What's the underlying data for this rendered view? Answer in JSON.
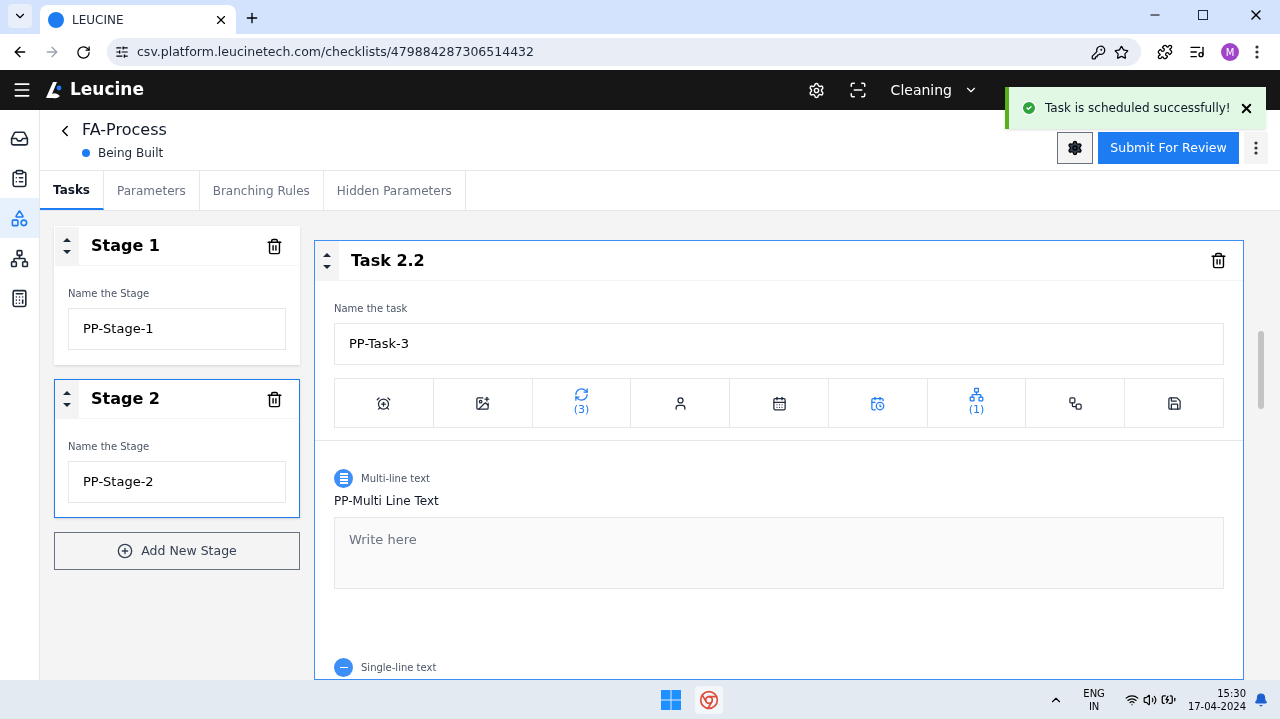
{
  "browser": {
    "tab_title": "LEUCINE",
    "url": "csv.platform.leucinetech.com/checklists/479884287306514432",
    "profile_initial": "M"
  },
  "header": {
    "brand": "Leucine",
    "facility": "Cleaning"
  },
  "toast": {
    "message": "Task is scheduled successfully!"
  },
  "page": {
    "title": "FA-Process",
    "status": "Being Built",
    "submit_label": "Submit For Review"
  },
  "sidebar": {
    "items": [
      {
        "kind": "inbox",
        "selected": false
      },
      {
        "kind": "checklist",
        "selected": false
      },
      {
        "kind": "flow",
        "selected": true
      },
      {
        "kind": "hierarchy",
        "selected": false
      },
      {
        "kind": "report",
        "selected": false
      }
    ]
  },
  "tabs": [
    {
      "label": "Tasks",
      "selected": true
    },
    {
      "label": "Parameters",
      "selected": false
    },
    {
      "label": "Branching Rules",
      "selected": false
    },
    {
      "label": "Hidden Parameters",
      "selected": false
    }
  ],
  "stages": [
    {
      "title": "Stage 1",
      "field_label": "Name the Stage",
      "value": "PP-Stage-1",
      "selected": false
    },
    {
      "title": "Stage 2",
      "field_label": "Name the Stage",
      "value": "PP-Stage-2",
      "selected": true
    }
  ],
  "add_stage": "Add New Stage",
  "task": {
    "title": "Task 2.2",
    "field_label": "Name the task",
    "value": "PP-Task-3",
    "toolbar": [
      {
        "kind": "timer",
        "active": false
      },
      {
        "kind": "media",
        "active": false
      },
      {
        "kind": "recurrence",
        "active": true,
        "count": "(3)"
      },
      {
        "kind": "assignee",
        "active": false
      },
      {
        "kind": "schedule-refresh",
        "active": false
      },
      {
        "kind": "schedule",
        "active": true
      },
      {
        "kind": "branch",
        "active": true,
        "count": "(1)"
      },
      {
        "kind": "interlock",
        "active": false
      },
      {
        "kind": "lock",
        "active": false
      }
    ],
    "parameters": [
      {
        "kind": "multi",
        "type_label": "Multi-line text",
        "name": "PP-Multi Line Text",
        "placeholder": "Write here"
      },
      {
        "kind": "single",
        "type_label": "Single-line text"
      }
    ]
  },
  "taskbar": {
    "lang": "ENG",
    "region": "IN",
    "time": "15:30",
    "date": "17-04-2024"
  }
}
